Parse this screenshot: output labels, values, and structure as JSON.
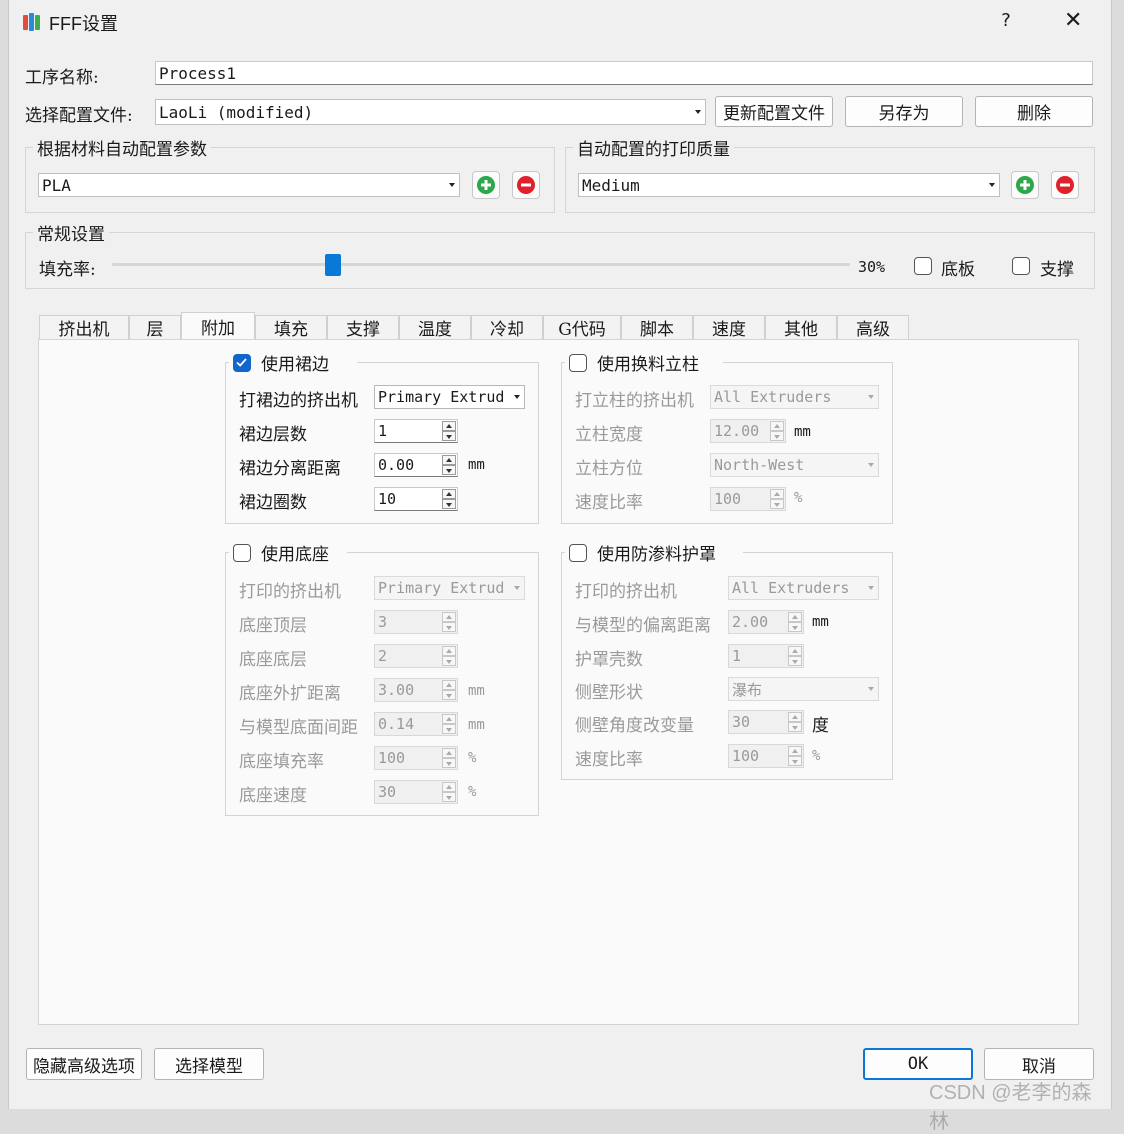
{
  "window": {
    "title": "FFF设置",
    "help": "?",
    "close": "✕"
  },
  "process_name": {
    "label": "工序名称:",
    "value": "Process1"
  },
  "profile": {
    "label": "选择配置文件:",
    "value": "LaoLi (modified)",
    "update_btn": "更新配置文件",
    "save_as_btn": "另存为",
    "delete_btn": "删除"
  },
  "material_group": {
    "title": "根据材料自动配置参数",
    "value": "PLA"
  },
  "quality_group": {
    "title": "自动配置的打印质量",
    "value": "Medium"
  },
  "general": {
    "title": "常规设置",
    "infill_label": "填充率:",
    "infill_value": "30%",
    "infill_fraction": 0.3,
    "raft_label": "底板",
    "support_label": "支撑"
  },
  "tabs": [
    "挤出机",
    "层",
    "附加",
    "填充",
    "支撑",
    "温度",
    "冷却",
    "G代码",
    "脚本",
    "速度",
    "其他",
    "高级"
  ],
  "skirt": {
    "title": "使用裙边",
    "rows": [
      {
        "label": "打裙边的挤出机",
        "value": "Primary Extrud"
      },
      {
        "label": "裙边层数",
        "value": "1"
      },
      {
        "label": "裙边分离距离",
        "value": "0.00",
        "unit": "mm"
      },
      {
        "label": "裙边圈数",
        "value": "10"
      }
    ]
  },
  "prime_pillar": {
    "title": "使用换料立柱",
    "rows": [
      {
        "label": "打立柱的挤出机",
        "value": "All Extruders"
      },
      {
        "label": "立柱宽度",
        "value": "12.00",
        "unit": "mm"
      },
      {
        "label": "立柱方位",
        "value": "North-West"
      },
      {
        "label": "速度比率",
        "value": "100",
        "unit": "%"
      }
    ]
  },
  "raft": {
    "title": "使用底座",
    "rows": [
      {
        "label": "打印的挤出机",
        "value": "Primary Extrud"
      },
      {
        "label": "底座顶层",
        "value": "3"
      },
      {
        "label": "底座底层",
        "value": "2"
      },
      {
        "label": "底座外扩距离",
        "value": "3.00",
        "unit": "mm"
      },
      {
        "label": "与模型底面间距",
        "value": "0.14",
        "unit": "mm"
      },
      {
        "label": "底座填充率",
        "value": "100",
        "unit": "%"
      },
      {
        "label": "底座速度",
        "value": "30",
        "unit": "%"
      }
    ]
  },
  "ooze_shield": {
    "title": "使用防渗料护罩",
    "rows": [
      {
        "label": "打印的挤出机",
        "value": "All Extruders"
      },
      {
        "label": "与模型的偏离距离",
        "value": "2.00",
        "unit": "mm"
      },
      {
        "label": "护罩壳数",
        "value": "1"
      },
      {
        "label": "侧壁形状",
        "value": "瀑布"
      },
      {
        "label": "侧壁角度改变量",
        "value": "30",
        "unit": "度"
      },
      {
        "label": "速度比率",
        "value": "100",
        "unit": "%"
      }
    ]
  },
  "footer": {
    "hide_advanced": "隐藏高级选项",
    "select_model": "选择模型",
    "ok": "OK",
    "cancel": "取消"
  },
  "watermark": "CSDN @老李的森林",
  "colors": {
    "accent": "#0a78d7",
    "add_green": "#2aa84a",
    "remove_red": "#e0202a"
  }
}
